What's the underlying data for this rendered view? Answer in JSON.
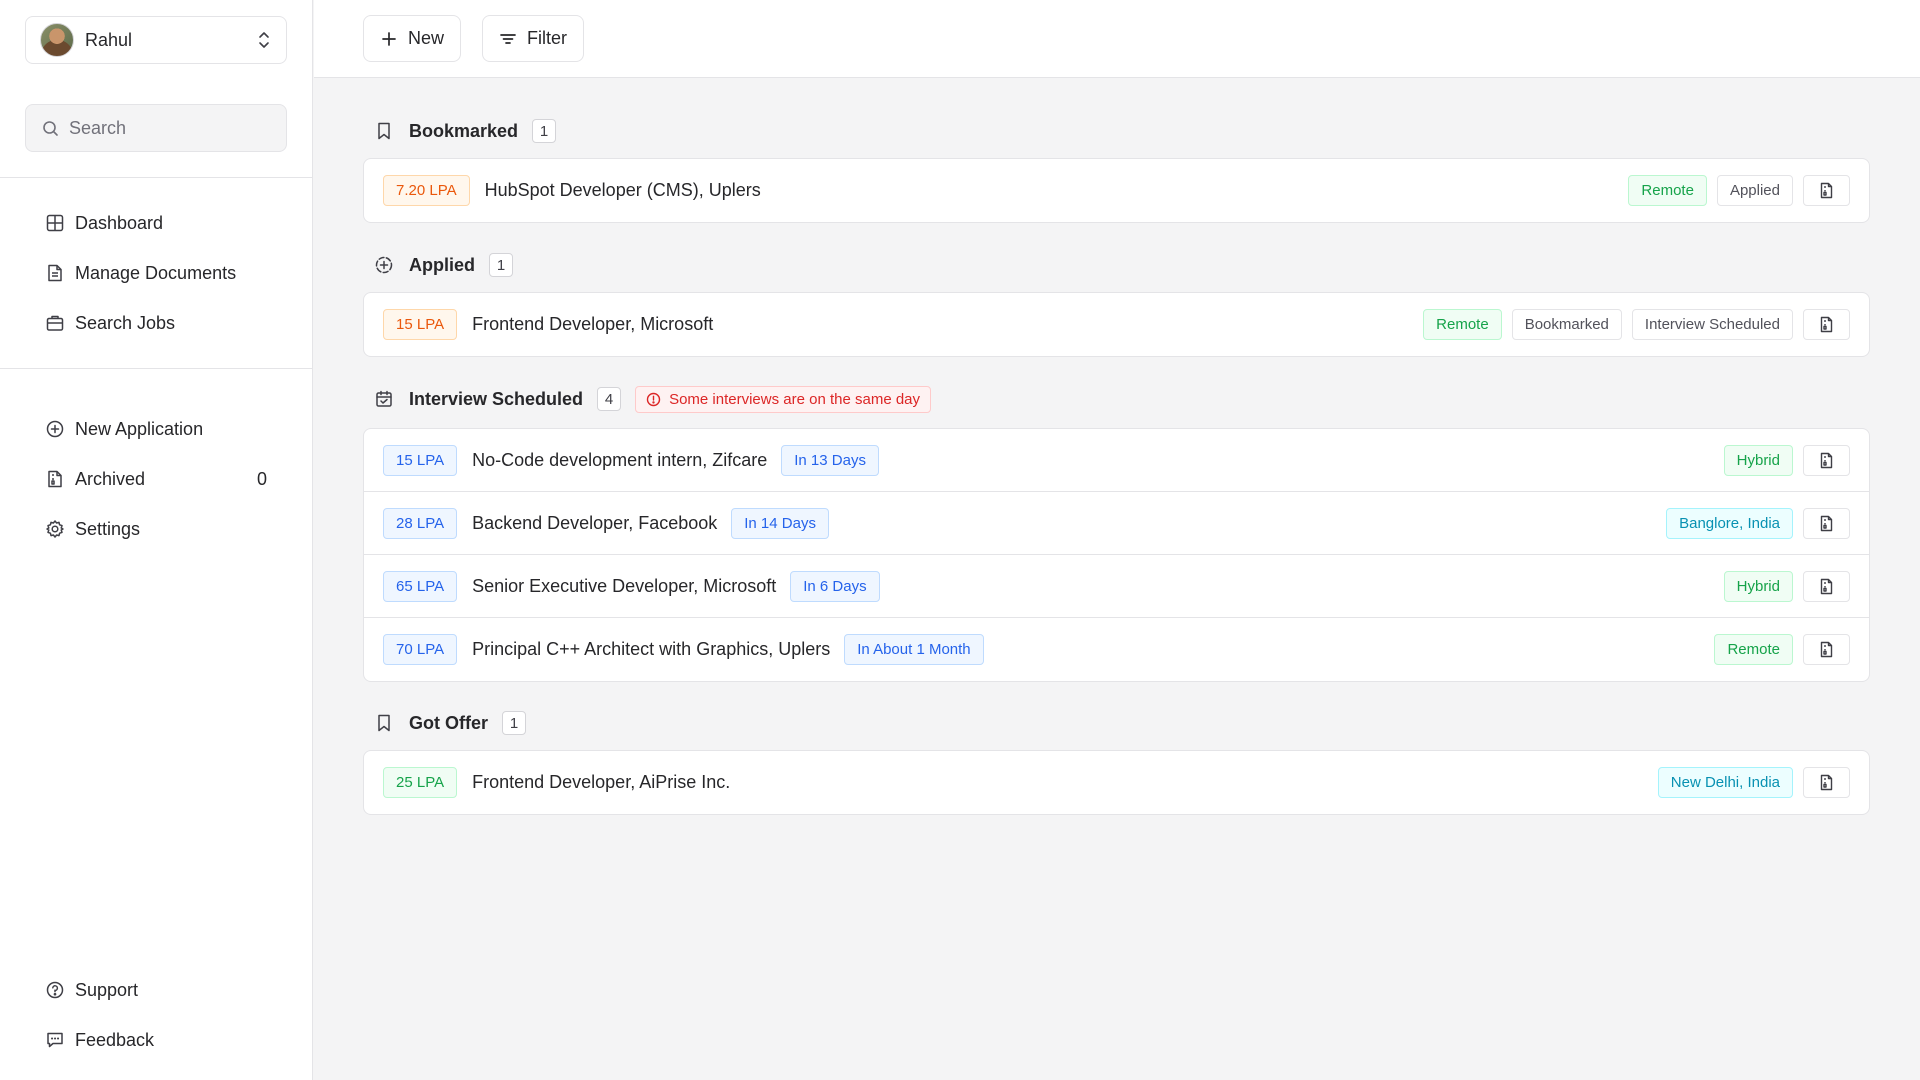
{
  "user": {
    "name": "Rahul"
  },
  "search": {
    "placeholder": "Search"
  },
  "nav_primary": [
    {
      "label": "Dashboard",
      "icon": "grid-icon"
    },
    {
      "label": "Manage Documents",
      "icon": "document-icon"
    },
    {
      "label": "Search Jobs",
      "icon": "briefcase-icon"
    }
  ],
  "nav_secondary": [
    {
      "label": "New Application",
      "icon": "plus-circle-icon"
    },
    {
      "label": "Archived",
      "icon": "archive-file-icon",
      "count": "0"
    },
    {
      "label": "Settings",
      "icon": "gear-icon"
    }
  ],
  "nav_footer": [
    {
      "label": "Support",
      "icon": "help-circle-icon"
    },
    {
      "label": "Feedback",
      "icon": "message-icon"
    }
  ],
  "toolbar": {
    "new_label": "New",
    "filter_label": "Filter"
  },
  "sections": [
    {
      "title": "Bookmarked",
      "count": "1",
      "icon": "bookmark-icon",
      "jobs": [
        {
          "salary": "7.20 LPA",
          "title": "HubSpot Developer (CMS), Uplers",
          "location": "Remote",
          "statuses": [
            "Applied"
          ]
        }
      ]
    },
    {
      "title": "Applied",
      "count": "1",
      "icon": "circle-plus-dashed-icon",
      "jobs": [
        {
          "salary": "15 LPA",
          "title": "Frontend Developer, Microsoft",
          "location": "Remote",
          "statuses": [
            "Bookmarked",
            "Interview Scheduled"
          ]
        }
      ]
    },
    {
      "title": "Interview Scheduled",
      "count": "4",
      "icon": "calendar-icon",
      "warning": "Some interviews are on the same day",
      "jobs": [
        {
          "salary": "15 LPA",
          "title": "No-Code development intern, Zifcare",
          "days": "In 13 Days",
          "location": "Hybrid"
        },
        {
          "salary": "28 LPA",
          "title": "Backend Developer, Facebook",
          "days": "In 14 Days",
          "location": "Banglore, India"
        },
        {
          "salary": "65 LPA",
          "title": "Senior Executive Developer, Microsoft",
          "days": "In 6 Days",
          "location": "Hybrid"
        },
        {
          "salary": "70 LPA",
          "title": "Principal C++ Architect with Graphics, Uplers",
          "days": "In About 1 Month",
          "location": "Remote"
        }
      ]
    },
    {
      "title": "Got Offer",
      "count": "1",
      "icon": "bookmark-icon",
      "jobs": [
        {
          "salary": "25 LPA",
          "title": "Frontend Developer, AiPrise Inc.",
          "location": "New Delhi, India"
        }
      ]
    }
  ],
  "colors": {
    "remote_hybrid": "#16a34a",
    "city": "#0891b2",
    "warning": "#dc2626",
    "accent_blue": "#2563eb",
    "salary_orange": "#ea580c"
  }
}
